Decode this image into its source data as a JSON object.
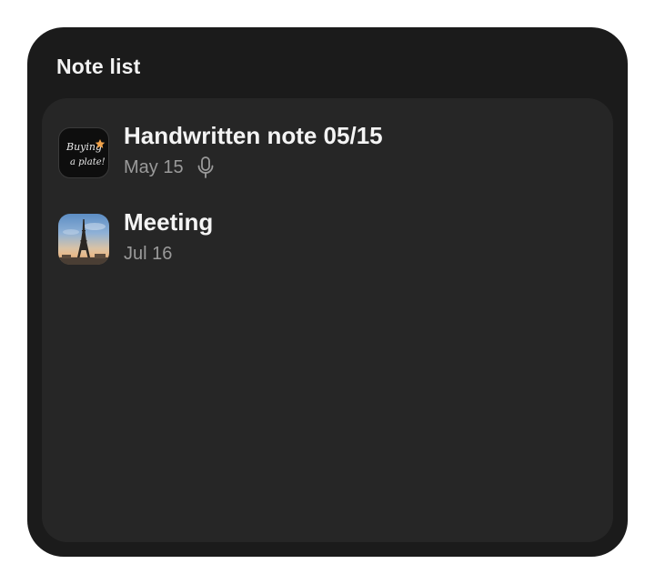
{
  "widget": {
    "title": "Note list"
  },
  "notes": [
    {
      "title": "Handwritten note 05/15",
      "date": "May 15",
      "thumbnail_text_line1": "Buying",
      "thumbnail_text_line2": "a plate!",
      "thumbnail_icon": "handwriting-thumbnail",
      "has_voice_recording": true,
      "voice_icon": "microphone-icon"
    },
    {
      "title": "Meeting",
      "date": "Jul 16",
      "thumbnail_icon": "eiffel-tower-photo-thumbnail",
      "has_voice_recording": false
    }
  ],
  "colors": {
    "widget_background": "#1b1b1b",
    "list_background": "#262626",
    "title_text": "#f4f4f4",
    "secondary_text": "#9a9a9a"
  }
}
